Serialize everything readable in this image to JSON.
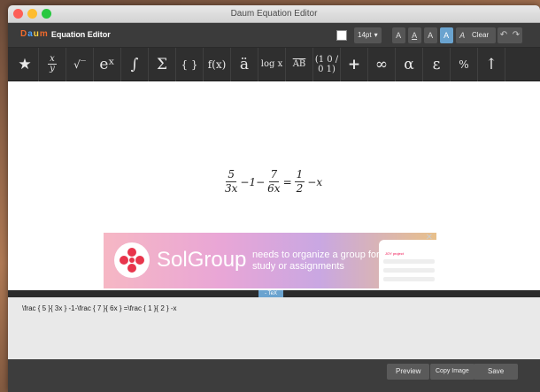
{
  "window": {
    "title": "Daum Equation Editor",
    "lights": {
      "close": "#fd5f57",
      "minimize": "#febc2e",
      "maximize": "#28c840"
    }
  },
  "brand": {
    "logo_d": "D",
    "logo_a": "a",
    "logo_u": "u",
    "logo_m": "m",
    "label": "Equation Editor"
  },
  "format": {
    "font_size": "14pt",
    "buttons": [
      "A",
      "A",
      "A",
      "A",
      "A"
    ],
    "clear": "Clear",
    "undo_icon": "↶",
    "redo_icon": "↷"
  },
  "toolbar": {
    "tools": [
      {
        "name": "star-icon",
        "label": "★"
      },
      {
        "name": "fraction-tool",
        "label": "x/y"
      },
      {
        "name": "sqrt-tool",
        "label": "√‾"
      },
      {
        "name": "exponent-tool",
        "label": "eˣ"
      },
      {
        "name": "integral-tool",
        "label": "∫"
      },
      {
        "name": "sum-tool",
        "label": "Σ"
      },
      {
        "name": "brackets-tool",
        "label": "{ }"
      },
      {
        "name": "function-tool",
        "label": "f(x)"
      },
      {
        "name": "accent-tool",
        "label": "ä"
      },
      {
        "name": "log-tool",
        "label": "log x"
      },
      {
        "name": "overline-tool",
        "label": "AB"
      },
      {
        "name": "matrix-tool",
        "label": "(1 0 / 0 1)"
      },
      {
        "name": "plus-tool",
        "label": "+"
      },
      {
        "name": "infinity-tool",
        "label": "∞"
      },
      {
        "name": "alpha-tool",
        "label": "α"
      },
      {
        "name": "epsilon-tool",
        "label": "ε"
      },
      {
        "name": "percent-tool",
        "label": "%"
      },
      {
        "name": "arrow-tool",
        "label": "↑"
      }
    ]
  },
  "equation": {
    "f1_num": "5",
    "f1_den": "3x",
    "mid1": "−1−",
    "f2_num": "7",
    "f2_den": "6x",
    "eq": "=",
    "f3_num": "1",
    "f3_den": "2",
    "tail": "−x"
  },
  "ad": {
    "brand": "SolGroup",
    "text": "needs to organize a group for study or assignments",
    "phone_title": "JOY project",
    "close": "✕"
  },
  "tex": {
    "tag": "- TeX",
    "source": "\\frac { 5 }{ 3x } -1-\\frac { 7 }{ 6x } =\\frac { 1 }{ 2 } -x"
  },
  "buttons": {
    "preview": "Preview",
    "copy": "Copy Image",
    "save": "Save"
  }
}
